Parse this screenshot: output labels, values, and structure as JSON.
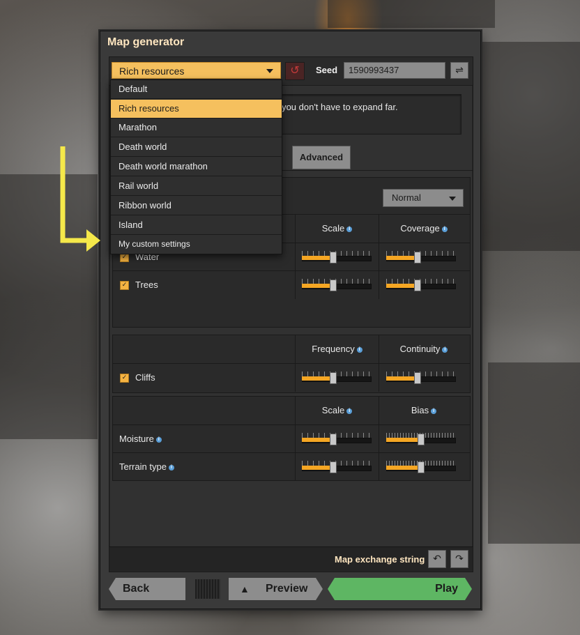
{
  "window": {
    "title": "Map generator"
  },
  "preset": {
    "selected": "Rich resources",
    "options": [
      "Default",
      "Rich resources",
      "Marathon",
      "Death world",
      "Death world marathon",
      "Rail world",
      "Ribbon world",
      "Island",
      "My custom settings"
    ]
  },
  "seed": {
    "label": "Seed",
    "value": "1590993437"
  },
  "description": {
    "visible_text": "s, so you don't have to expand far."
  },
  "tabs": {
    "advanced": "Advanced"
  },
  "water_setting": {
    "value": "Normal"
  },
  "terrain": {
    "headers": {
      "scale": "Scale",
      "coverage": "Coverage"
    },
    "rows": [
      {
        "label": "Water",
        "checked": true,
        "scale": 0.45,
        "coverage": 0.45
      },
      {
        "label": "Trees",
        "checked": true,
        "scale": 0.45,
        "coverage": 0.45
      }
    ]
  },
  "cliffs": {
    "headers": {
      "frequency": "Frequency",
      "continuity": "Continuity"
    },
    "rows": [
      {
        "label": "Cliffs",
        "checked": true,
        "frequency": 0.45,
        "continuity": 0.45
      }
    ]
  },
  "climate": {
    "headers": {
      "scale": "Scale",
      "bias": "Bias"
    },
    "rows": [
      {
        "label": "Moisture",
        "scale": 0.45,
        "bias": 0.5
      },
      {
        "label": "Terrain type",
        "scale": 0.45,
        "bias": 0.5
      }
    ]
  },
  "exchange": {
    "label": "Map exchange string"
  },
  "footer": {
    "back": "Back",
    "preview": "Preview",
    "play": "Play"
  },
  "colors": {
    "accent": "#f5c05e",
    "slider_fill": "#f5a623",
    "play": "#5eb663",
    "annotation_arrow": "#f5e84a"
  },
  "icons": {
    "reset": "undo-icon",
    "shuffle": "shuffle-icon",
    "info": "info-icon",
    "warning": "warning-icon",
    "import": "import-icon",
    "export": "export-icon"
  }
}
